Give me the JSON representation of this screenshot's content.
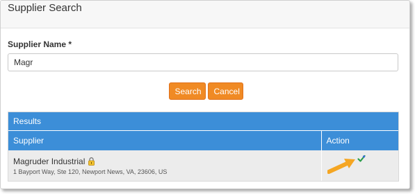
{
  "header": {
    "title": "Supplier Search"
  },
  "form": {
    "supplier_name_label": "Supplier Name *",
    "supplier_name_value": "Magr"
  },
  "buttons": {
    "search": "Search",
    "cancel": "Cancel"
  },
  "results": {
    "title": "Results",
    "columns": [
      "Supplier",
      "Action"
    ],
    "rows": [
      {
        "name": "Magruder Industrial",
        "address": "1 Bayport Way, Ste 120, Newport News, VA, 23606, US",
        "lock_icon": "lock-icon",
        "action_icon": "select-check-icon"
      }
    ]
  },
  "colors": {
    "accent_blue": "#3c8ed8",
    "button_orange": "#f08a24",
    "arrow_orange": "#f5a623"
  }
}
